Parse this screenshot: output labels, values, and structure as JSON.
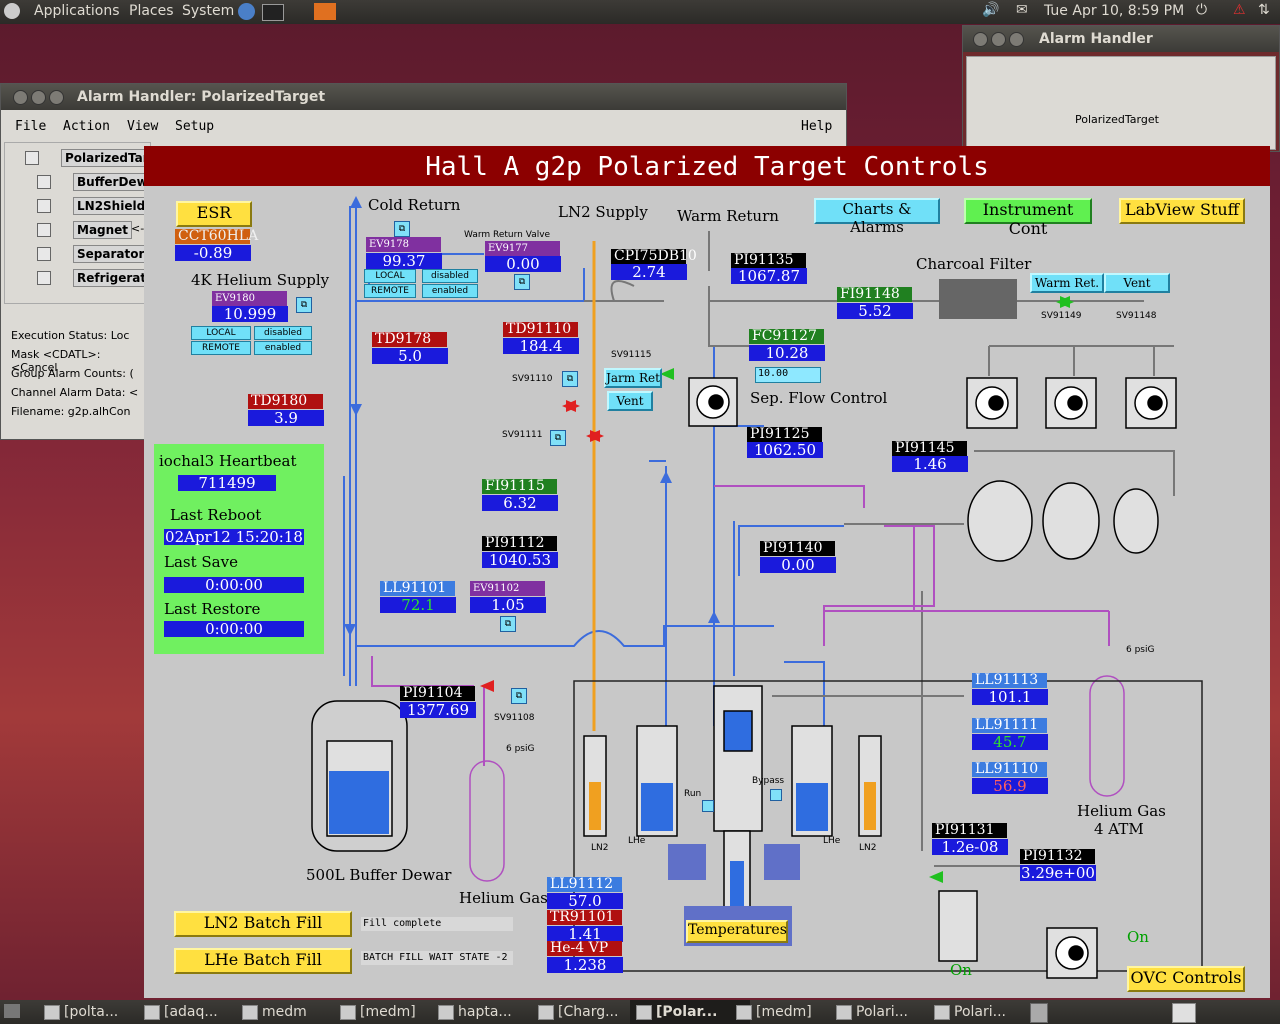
{
  "top_panel": {
    "menus": [
      "Applications",
      "Places",
      "System"
    ],
    "clock": "Tue Apr 10,  8:59 PM"
  },
  "alarm_handler_small": {
    "title": "Alarm Handler",
    "group": "PolarizedTarget"
  },
  "alarm_handler": {
    "title": "Alarm Handler: PolarizedTarget",
    "menu": [
      "File",
      "Action",
      "View",
      "Setup"
    ],
    "help": "Help",
    "groups": [
      "PolarizedTarge",
      "BufferDewa",
      "LN2Shield",
      "Magnet",
      "Separator",
      "Refrigerator"
    ],
    "magnet_extra": "<--",
    "status": {
      "exec": "Execution Status:  Loc",
      "mask": "Mask <CDATL>:   <Cancel",
      "group_counts": "Group Alarm Counts:  (",
      "channel": "Channel Alarm Data:  <",
      "filename": "Filename:     g2p.alhCon"
    }
  },
  "medm": {
    "title": "Hall A g2p Polarized Target Controls",
    "buttons": {
      "esr": "ESR",
      "charts": "Charts & Alarms",
      "instrument": "Instrument Cont",
      "labview": "LabView Stuff",
      "ln2_fill": "LN2 Batch Fill",
      "lhe_fill": "LHe Batch Fill",
      "temps": "Temperatures",
      "ovc": "OVC Controls",
      "warm_ret": "Warm Ret.",
      "vent_top": "Vent",
      "jarm_ret": "Jarm Ret",
      "vent_mid": "Vent"
    },
    "labels": {
      "cold_return": "Cold Return",
      "ln2_supply": "LN2 Supply",
      "warm_return": "Warm Return",
      "charcoal": "Charcoal Filter",
      "he_supply": "4K Helium Supply",
      "warm_return_valve": "Warm Return Valve",
      "sep_flow": "Sep. Flow Control",
      "heartbeat": "iochal3 Heartbeat",
      "last_reboot": "Last Reboot",
      "last_save": "Last Save",
      "last_restore": "Last Restore",
      "dewar": "500L Buffer Dewar",
      "he_gas_left": "Helium Gas",
      "he_gas_right": "Helium Gas",
      "he_gas_atm": "4 ATM",
      "ln2_a": "LN2",
      "lhe_a": "LHe",
      "lhe_b": "LHe",
      "ln2_b": "LN2",
      "run": "Run",
      "bypass": "Bypass",
      "psig_left": "6 psiG",
      "psig_right": "6 psiG",
      "on_a": "On",
      "on_b": "On"
    },
    "valves": {
      "sv91149": "SV91149",
      "sv91148": "SV91148",
      "sv91115": "SV91115",
      "sv91110": "SV91110",
      "sv91111": "SV91111",
      "sv91108": "SV91108"
    },
    "switches": {
      "local": "LOCAL",
      "disabled": "disabled",
      "remote": "REMOTE",
      "enabled": "enabled"
    },
    "readings": {
      "cct60hla": {
        "name": "CCT60HLA",
        "value": "-0.89"
      },
      "ev9178": {
        "name": "EV9178",
        "value": "99.37"
      },
      "ev9177": {
        "name": "EV9177",
        "value": "0.00"
      },
      "ev9180": {
        "name": "EV9180",
        "value": "10.999"
      },
      "cpi75db10": {
        "name": "CPI75DB10",
        "value": "2.74"
      },
      "pi91135": {
        "name": "PI91135",
        "value": "1067.87"
      },
      "fi91148": {
        "name": "FI91148",
        "value": "5.52"
      },
      "td9178": {
        "name": "TD9178",
        "value": "5.0"
      },
      "td91110": {
        "name": "TD91110",
        "value": "184.4"
      },
      "fc91127": {
        "name": "FC91127",
        "value": "10.28",
        "setpoint": "10.00"
      },
      "td9180": {
        "name": "TD9180",
        "value": "3.9"
      },
      "pi91125": {
        "name": "PI91125",
        "value": "1062.50"
      },
      "pi91145": {
        "name": "PI91145",
        "value": "1.46"
      },
      "fi91115": {
        "name": "FI91115",
        "value": "6.32"
      },
      "pi91112": {
        "name": "PI91112",
        "value": "1040.53"
      },
      "pi91140": {
        "name": "PI91140",
        "value": "0.00"
      },
      "ll91101": {
        "name": "LL91101",
        "value": "72.1"
      },
      "ev91102": {
        "name": "EV91102",
        "value": "1.05"
      },
      "pi91104": {
        "name": "PI91104",
        "value": "1377.69"
      },
      "ll91113": {
        "name": "LL91113",
        "value": "101.1"
      },
      "ll91111": {
        "name": "LL91111",
        "value": "45.7"
      },
      "ll91110": {
        "name": "LL91110",
        "value": "56.9"
      },
      "pi91131": {
        "name": "PI91131",
        "value": "1.2e-08"
      },
      "pi91132": {
        "name": "PI91132",
        "value": "3.29e+00"
      },
      "ll91112": {
        "name": "LL91112",
        "value": "57.0"
      },
      "tr91101": {
        "name": "TR91101",
        "value": "1.41"
      },
      "he4vp": {
        "name": "He-4 VP",
        "value": "1.238"
      }
    },
    "heartbeat": {
      "count": "711499",
      "reboot": "02Apr12 15:20:18",
      "save": "0:00:00",
      "restore": "0:00:00"
    },
    "messages": {
      "ln2": "Fill complete",
      "lhe": "BATCH FILL WAIT STATE -2"
    },
    "colors": {
      "title_bg": "#8c0000",
      "value_bg": "#1a1adc",
      "pipe_blue": "#3c6cdc",
      "pipe_orange": "#f0a020",
      "pipe_purple": "#b050c0"
    }
  },
  "taskbar": {
    "items": [
      "[polta...",
      "[adaq...",
      "medm",
      "[medm]",
      "hapta...",
      "[Charg...",
      "[Polar...",
      "[medm]",
      "Polari...",
      "Polari..."
    ]
  }
}
